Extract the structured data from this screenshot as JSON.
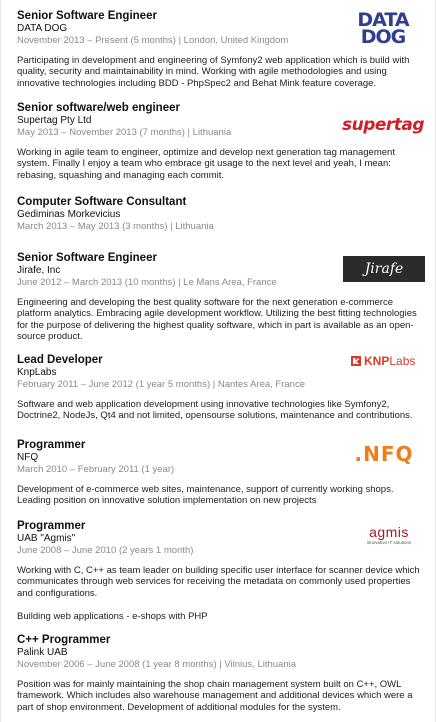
{
  "entries": [
    {
      "title": "Senior Software Engineer",
      "company": "DATA DOG",
      "meta": "November 2013 – Present (5 months) | London, United Kingdom",
      "desc": [
        "Participating in development and engineering of Symfony2 web application which is build with quality, security and maintainability in mind. Working with agile methodologies and using innovative technologies including BDD - PhpSpec2 and Behat Mink feature coverage."
      ],
      "logo": {
        "icon": "datadog-logo",
        "line1": "DATA",
        "line2": "DOG",
        "color": "#2e3e91"
      }
    },
    {
      "title": "Senior software/web engineer",
      "company": "Supertag Pty Ltd",
      "meta": "May 2013 – November 2013 (7 months) | Lithuania",
      "desc": [
        "Working in agile team to engineer, optimize and develop next generation tag management system. Finally I enjoy a team who embrace git usage to the next level and yeah, I mean: rebasing, squashing and managing each commit."
      ],
      "logo": {
        "icon": "supertag-logo",
        "text": "supertag",
        "color": "#d21f26"
      }
    },
    {
      "title": "Computer Software Consultant",
      "company": "Gediminas Morkevicius",
      "meta": "March 2013 – May 2013 (3 months) | Lithuania",
      "desc": []
    },
    {
      "title": "Senior Software Engineer",
      "company": "Jirafe, Inc",
      "meta": "June 2012 – March 2013 (10 months) | Le Mans Area, France",
      "desc": [
        "Engineering and developing the best quality software for the next generation e-commerce platform analytics. Embracing agile development workflow. Utilizing the best fitting technologies for the purpose of delivering the highest quality software, which in part is available as an open-source product."
      ],
      "logo": {
        "icon": "jirafe-logo",
        "text": "Jirafe"
      }
    },
    {
      "title": "Lead Developer",
      "company": "KnpLabs",
      "meta": "February 2011 – June 2012 (1 year 5 months) | Nantes Area, France",
      "desc": [
        "Software and web application development using innovative technologies like Symfony2, Doctrine2, NodeJs, Qt4 and not limited, opensourse solutions, maintenance and contributions."
      ],
      "logo": {
        "icon": "knplabs-logo",
        "bold": "KNP",
        "rest": "Labs",
        "color": "#d93a2b"
      }
    },
    {
      "title": "Programmer",
      "company": "NFQ",
      "meta": "March 2010 – February 2011 (1 year)",
      "desc": [
        "Development of e-commerce web sites, maintenance, support of currently working shops. Leading position on innovative solution implementation on new projects"
      ],
      "logo": {
        "icon": "nfq-logo",
        "text": ".NFQ",
        "color": "#f07d1a"
      }
    },
    {
      "title": "Programmer",
      "company": "UAB \"Agmis\"",
      "meta": "June 2008 – June 2010 (2 years 1 month)",
      "desc": [
        "Working with C, C++ as team leader on building specific user interface for scanner device which communicates through web services for receiving the metadata on commonly used properties and configurations.",
        "Building web applications - e-shops with PHP"
      ],
      "logo": {
        "icon": "agmis-logo",
        "text": "agmis",
        "tagline": "innovative IT solutions",
        "color": "#9b1b2c"
      }
    },
    {
      "title": "C++ Programmer",
      "company": "Palink UAB",
      "meta": "November 2006 – June 2008 (1 year 8 months) | Vilnius, Lithuania",
      "desc": [
        "Position was for mainly maintaining the shop chain management system built on C++, OWL framework. Which includes also warehouse management and additional devices which were a part of shop environment. Development of additional modules for the system."
      ]
    }
  ]
}
